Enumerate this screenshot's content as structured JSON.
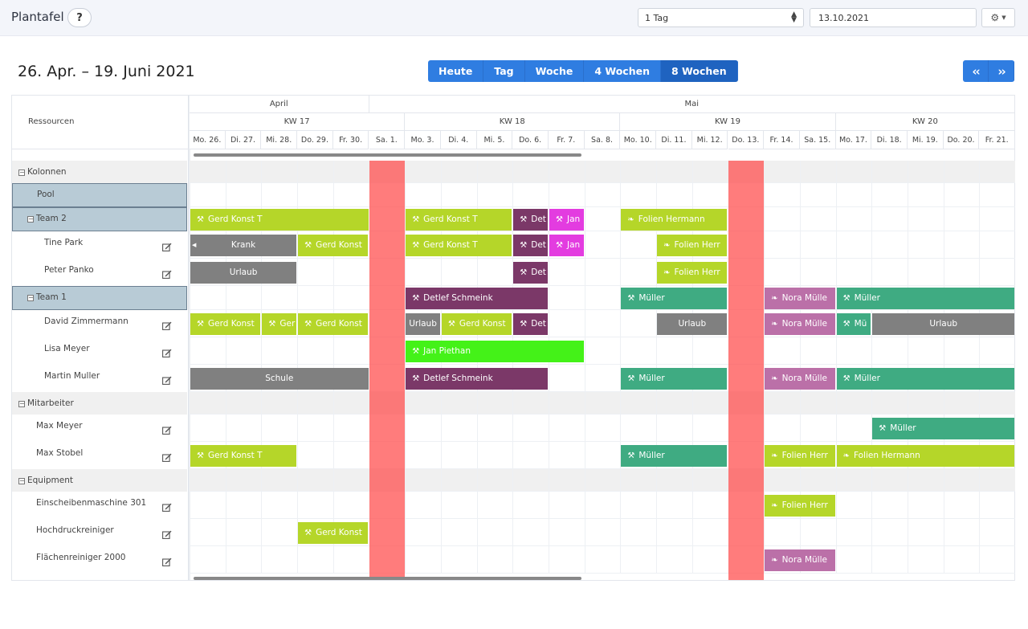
{
  "app": {
    "title": "Plantafel",
    "help_label": "?",
    "range_select": "1 Tag",
    "date_value": "13.10.2021",
    "gear_icon": "gear-icon"
  },
  "range_title": "26. Apr. – 19. Juni 2021",
  "view_buttons": [
    "Heute",
    "Tag",
    "Woche",
    "4 Wochen",
    "8 Wochen"
  ],
  "active_view": "8 Wochen",
  "nav_buttons": [
    "<<",
    ">>"
  ],
  "header": {
    "resources_label": "Ressourcen",
    "months": [
      {
        "label": "April",
        "from": 0,
        "span": 5
      },
      {
        "label": "Mai",
        "from": 5,
        "span": 18
      }
    ],
    "weeks": [
      {
        "label": "KW 17",
        "from": 0,
        "span": 6
      },
      {
        "label": "KW 18",
        "from": 6,
        "span": 6
      },
      {
        "label": "KW 19",
        "from": 12,
        "span": 6
      },
      {
        "label": "KW 20",
        "from": 18,
        "span": 5
      }
    ],
    "days": [
      "Mo. 26.",
      "Di. 27.",
      "Mi. 28.",
      "Do. 29.",
      "Fr. 30.",
      "Sa. 1.",
      "Mo. 3.",
      "Di. 4.",
      "Mi. 5.",
      "Do. 6.",
      "Fr. 7.",
      "Sa. 8.",
      "Mo. 10.",
      "Di. 11.",
      "Mi. 12.",
      "Do. 13.",
      "Fr. 14.",
      "Sa. 15.",
      "Mo. 17.",
      "Di. 18.",
      "Mi. 19.",
      "Do. 20.",
      "Fr. 21."
    ]
  },
  "highlight_days": [
    5,
    15
  ],
  "colors": {
    "lime": "#b5d629",
    "magenta": "#e33ce0",
    "plum": "#7b3868",
    "gray": "#808080",
    "teal": "#3fab82",
    "mauve": "#bb70a8",
    "green": "#44f218",
    "highlight": "#ff6464",
    "primary": "#2f7de1"
  },
  "rows": [
    {
      "label": "Kolonnen",
      "kind": "group",
      "toggle": true
    },
    {
      "label": "Pool",
      "kind": "selected",
      "indent": 2,
      "events": []
    },
    {
      "label": "Team 2",
      "kind": "selected",
      "toggle": true,
      "indent": 1,
      "events": [
        {
          "label": "Gerd Konst T",
          "from": 0,
          "span": 5,
          "color": "lime",
          "icon": "hammer-icon"
        },
        {
          "label": "Gerd Konst T",
          "from": 6,
          "span": 3,
          "color": "lime",
          "icon": "hammer-icon"
        },
        {
          "label": "Det",
          "from": 9,
          "span": 1,
          "color": "plum",
          "icon": "hammer-icon"
        },
        {
          "label": "Jan",
          "from": 10,
          "span": 1,
          "color": "magenta",
          "icon": "hammer-icon"
        },
        {
          "label": "Folien Hermann",
          "from": 12,
          "span": 3,
          "color": "lime",
          "icon": "leaf-icon"
        }
      ]
    },
    {
      "label": "Tine Park",
      "kind": "person",
      "indent": 3,
      "edit": true,
      "events": [
        {
          "label": "Krank",
          "from": 0,
          "span": 3,
          "color": "gray",
          "center": true,
          "leftArrow": true
        },
        {
          "label": "Gerd Konst",
          "from": 3,
          "span": 2,
          "color": "lime",
          "icon": "hammer-icon"
        },
        {
          "label": "Gerd Konst T",
          "from": 6,
          "span": 3,
          "color": "lime",
          "icon": "hammer-icon"
        },
        {
          "label": "Det",
          "from": 9,
          "span": 1,
          "color": "plum",
          "icon": "hammer-icon"
        },
        {
          "label": "Jan",
          "from": 10,
          "span": 1,
          "color": "magenta",
          "icon": "hammer-icon"
        },
        {
          "label": "Folien Herr",
          "from": 13,
          "span": 2,
          "color": "lime",
          "icon": "leaf-icon"
        }
      ]
    },
    {
      "label": "Peter Panko",
      "kind": "person",
      "indent": 3,
      "edit": true,
      "events": [
        {
          "label": "Urlaub",
          "from": 0,
          "span": 3,
          "color": "gray",
          "center": true
        },
        {
          "label": "Det",
          "from": 9,
          "span": 1,
          "color": "plum",
          "icon": "hammer-icon"
        },
        {
          "label": "Folien Herr",
          "from": 13,
          "span": 2,
          "color": "lime",
          "icon": "leaf-icon"
        }
      ]
    },
    {
      "label": "Team 1",
      "kind": "selected",
      "toggle": true,
      "indent": 1,
      "events": [
        {
          "label": "Detlef Schmeink",
          "from": 6,
          "span": 4,
          "color": "plum",
          "icon": "hammer-icon"
        },
        {
          "label": "Müller",
          "from": 12,
          "span": 3,
          "color": "teal",
          "icon": "hammer-icon"
        },
        {
          "label": "Nora Mülle",
          "from": 16,
          "span": 2,
          "color": "mauve",
          "icon": "leaf-icon"
        },
        {
          "label": "Müller",
          "from": 18,
          "span": 5,
          "color": "teal",
          "icon": "hammer-icon"
        }
      ]
    },
    {
      "label": "David Zimmermann",
      "kind": "person",
      "indent": 3,
      "edit": true,
      "events": [
        {
          "label": "Gerd Konst",
          "from": 0,
          "span": 2,
          "color": "lime",
          "icon": "hammer-icon"
        },
        {
          "label": "Ger",
          "from": 2,
          "span": 1,
          "color": "lime",
          "icon": "hammer-icon"
        },
        {
          "label": "Gerd Konst",
          "from": 3,
          "span": 2,
          "color": "lime",
          "icon": "hammer-icon"
        },
        {
          "label": "Urlaub",
          "from": 6,
          "span": 1,
          "color": "gray",
          "center": true
        },
        {
          "label": "Gerd Konst",
          "from": 7,
          "span": 2,
          "color": "lime",
          "icon": "hammer-icon"
        },
        {
          "label": "Det",
          "from": 9,
          "span": 1,
          "color": "plum",
          "icon": "hammer-icon"
        },
        {
          "label": "Urlaub",
          "from": 13,
          "span": 2,
          "color": "gray",
          "center": true
        },
        {
          "label": "Nora Mülle",
          "from": 16,
          "span": 2,
          "color": "mauve",
          "icon": "leaf-icon"
        },
        {
          "label": "Mü",
          "from": 18,
          "span": 1,
          "color": "teal",
          "icon": "hammer-icon"
        },
        {
          "label": "Urlaub",
          "from": 19,
          "span": 4,
          "color": "gray",
          "center": true
        }
      ]
    },
    {
      "label": "Lisa Meyer",
      "kind": "person",
      "indent": 3,
      "edit": true,
      "events": [
        {
          "label": "Jan Piethan",
          "from": 6,
          "span": 5,
          "color": "green",
          "icon": "hammer-icon"
        }
      ]
    },
    {
      "label": "Martin Muller",
      "kind": "person",
      "indent": 3,
      "edit": true,
      "events": [
        {
          "label": "Schule",
          "from": 0,
          "span": 5,
          "color": "gray",
          "center": true
        },
        {
          "label": "Detlef Schmeink",
          "from": 6,
          "span": 4,
          "color": "plum",
          "icon": "hammer-icon"
        },
        {
          "label": "Müller",
          "from": 12,
          "span": 3,
          "color": "teal",
          "icon": "hammer-icon"
        },
        {
          "label": "Nora Mülle",
          "from": 16,
          "span": 2,
          "color": "mauve",
          "icon": "leaf-icon"
        },
        {
          "label": "Müller",
          "from": 18,
          "span": 5,
          "color": "teal",
          "icon": "hammer-icon"
        }
      ]
    },
    {
      "label": "Mitarbeiter",
      "kind": "group",
      "toggle": true
    },
    {
      "label": "Max Meyer",
      "kind": "person",
      "indent": 2,
      "edit": true,
      "events": [
        {
          "label": "Müller",
          "from": 19,
          "span": 4,
          "color": "teal",
          "icon": "hammer-icon"
        }
      ]
    },
    {
      "label": "Max Stobel",
      "kind": "person",
      "indent": 2,
      "edit": true,
      "events": [
        {
          "label": "Gerd Konst T",
          "from": 0,
          "span": 3,
          "color": "lime",
          "icon": "hammer-icon"
        },
        {
          "label": "Müller",
          "from": 12,
          "span": 3,
          "color": "teal",
          "icon": "hammer-icon"
        },
        {
          "label": "Folien Herr",
          "from": 16,
          "span": 2,
          "color": "lime",
          "icon": "leaf-icon"
        },
        {
          "label": "Folien Hermann",
          "from": 18,
          "span": 5,
          "color": "lime",
          "icon": "leaf-icon"
        }
      ]
    },
    {
      "label": "Equipment",
      "kind": "group",
      "toggle": true
    },
    {
      "label": "Einscheibenmaschine 301",
      "kind": "person",
      "indent": 2,
      "edit": true,
      "events": [
        {
          "label": "Folien Herr",
          "from": 16,
          "span": 2,
          "color": "lime",
          "icon": "leaf-icon"
        }
      ]
    },
    {
      "label": "Hochdruckreiniger",
      "kind": "person",
      "indent": 2,
      "edit": true,
      "events": [
        {
          "label": "Gerd Konst",
          "from": 3,
          "span": 2,
          "color": "lime",
          "icon": "hammer-icon"
        }
      ]
    },
    {
      "label": "Flächenreiniger 2000",
      "kind": "person",
      "indent": 2,
      "edit": true,
      "events": [
        {
          "label": "Nora Mülle",
          "from": 16,
          "span": 2,
          "color": "mauve",
          "icon": "leaf-icon"
        }
      ]
    }
  ]
}
